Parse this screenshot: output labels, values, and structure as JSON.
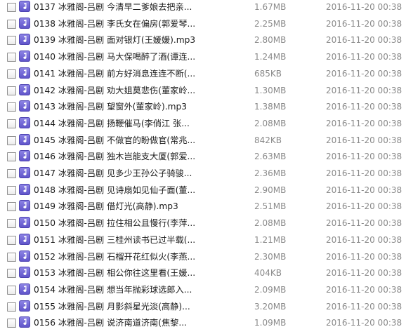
{
  "files": [
    {
      "name": "0137 冰雅阁-吕剧 今清早二爹娘去把亲...",
      "size": "1.67MB",
      "date": "2016-11-20 00:38",
      "icon": "music-file-icon"
    },
    {
      "name": "0138 冰雅阁-吕剧 李氏女在偏房(郭爱琴...",
      "size": "2.25MB",
      "date": "2016-11-20 00:38",
      "icon": "music-file-icon"
    },
    {
      "name": "0139 冰雅阁-吕剧 面对银灯(王媛媛).mp3",
      "size": "2.80MB",
      "date": "2016-11-20 00:38",
      "icon": "music-file-icon"
    },
    {
      "name": "0140 冰雅阁-吕剧 马大保喝醉了酒(谭连...",
      "size": "1.24MB",
      "date": "2016-11-20 00:38",
      "icon": "music-file-icon"
    },
    {
      "name": "0141 冰雅阁-吕剧 前方好消息连连不断(...",
      "size": "685KB",
      "date": "2016-11-20 00:38",
      "icon": "music-file-icon"
    },
    {
      "name": "0142 冰雅阁-吕剧 劝大姐莫悲伤(董家岭...",
      "size": "1.30MB",
      "date": "2016-11-20 00:38",
      "icon": "music-file-icon"
    },
    {
      "name": "0143 冰雅阁-吕剧 望窗外(董家岭).mp3",
      "size": "1.38MB",
      "date": "2016-11-20 00:38",
      "icon": "music-file-icon"
    },
    {
      "name": "0144 冰雅阁-吕剧 扬鞭催马(李俏江 张...",
      "size": "2.08MB",
      "date": "2016-11-20 00:38",
      "icon": "music-file-icon"
    },
    {
      "name": "0145 冰雅阁-吕剧 不做官的盼做官(常兆...",
      "size": "842KB",
      "date": "2016-11-20 00:38",
      "icon": "music-file-icon"
    },
    {
      "name": "0146 冰雅阁-吕剧 独木岂能支大厦(郭爱...",
      "size": "2.63MB",
      "date": "2016-11-20 00:38",
      "icon": "music-file-icon"
    },
    {
      "name": "0147 冰雅阁-吕剧 见多少王孙公子骑骏...",
      "size": "2.36MB",
      "date": "2016-11-20 00:38",
      "icon": "music-file-icon"
    },
    {
      "name": "0148 冰雅阁-吕剧 见诗扇如见仙子面(董...",
      "size": "2.90MB",
      "date": "2016-11-20 00:38",
      "icon": "music-file-icon"
    },
    {
      "name": "0149 冰雅阁-吕剧 借灯光(高静).mp3",
      "size": "2.51MB",
      "date": "2016-11-20 00:38",
      "icon": "music-file-icon"
    },
    {
      "name": "0150 冰雅阁-吕剧 拉住相公且慢行(李萍...",
      "size": "2.08MB",
      "date": "2016-11-20 00:38",
      "icon": "music-file-icon"
    },
    {
      "name": "0151 冰雅阁-吕剧 三桂州读书已过半载(...",
      "size": "1.21MB",
      "date": "2016-11-20 00:38",
      "icon": "music-file-icon"
    },
    {
      "name": "0152 冰雅阁-吕剧 石榴开花红似火(李燕...",
      "size": "2.30MB",
      "date": "2016-11-20 00:38",
      "icon": "music-file-icon"
    },
    {
      "name": "0153 冰雅阁-吕剧 相公你往这里看(王媛...",
      "size": "404KB",
      "date": "2016-11-20 00:38",
      "icon": "music-file-icon"
    },
    {
      "name": "0154 冰雅阁-吕剧 想当年抛彩球选郎入...",
      "size": "2.09MB",
      "date": "2016-11-20 00:38",
      "icon": "music-file-icon"
    },
    {
      "name": "0155 冰雅阁-吕剧 月影斜星光淡(高静)...",
      "size": "3.20MB",
      "date": "2016-11-20 00:38",
      "icon": "music-file-icon"
    },
    {
      "name": "0156 冰雅阁-吕剧 说济南道济南(焦黎...",
      "size": "1.09MB",
      "date": "2016-11-20 00:38",
      "icon": "music-file-icon"
    }
  ],
  "colors": {
    "icon_purple": "#6a5fd6",
    "meta_text": "#8a8a8a",
    "name_text": "#1a1a1a"
  }
}
